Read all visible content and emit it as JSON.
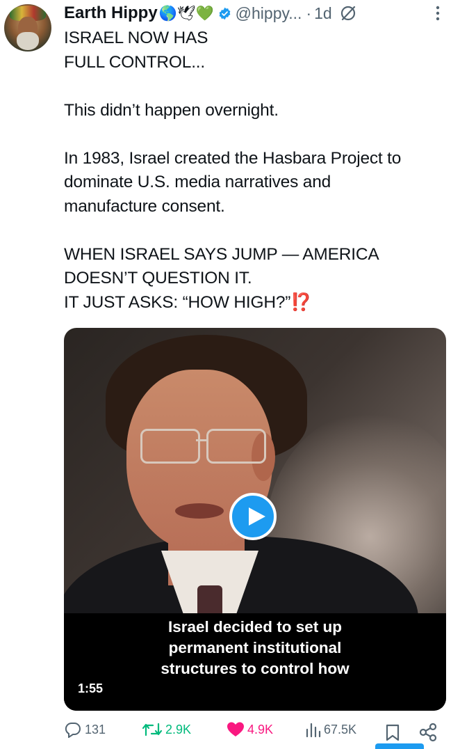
{
  "author": {
    "name": "Earth Hippy",
    "emoji": "🌎🕊💚",
    "handle": "@hippy...",
    "separator": "·",
    "time": "1d"
  },
  "tweet": {
    "lines": [
      "ISRAEL NOW HAS",
      "FULL CONTROL...",
      "",
      "This didn’t happen overnight.",
      "",
      "In 1983, Israel created the Hasbara Project to",
      "dominate U.S. media narratives and",
      "manufacture consent.",
      "",
      "WHEN ISRAEL SAYS JUMP — AMERICA",
      "DOESN’T QUESTION IT.",
      "IT JUST ASKS: “HOW HIGH?”"
    ],
    "trailing_emoji": "⁉️"
  },
  "video": {
    "caption_lines": [
      "Israel decided to set up",
      "permanent institutional",
      "structures to control how"
    ],
    "duration": "1:55"
  },
  "actions": {
    "replies": "131",
    "retweets": "2.9K",
    "likes": "4.9K",
    "views": "67.5K"
  },
  "colors": {
    "accent": "#1d9bf0",
    "retweet": "#00ba7c",
    "like": "#f91880",
    "muted": "#536471"
  },
  "icons": [
    "reply-icon",
    "retweet-icon",
    "like-icon",
    "views-icon",
    "bookmark-icon",
    "share-icon",
    "verified-icon",
    "grok-icon",
    "more-icon",
    "play-icon"
  ]
}
